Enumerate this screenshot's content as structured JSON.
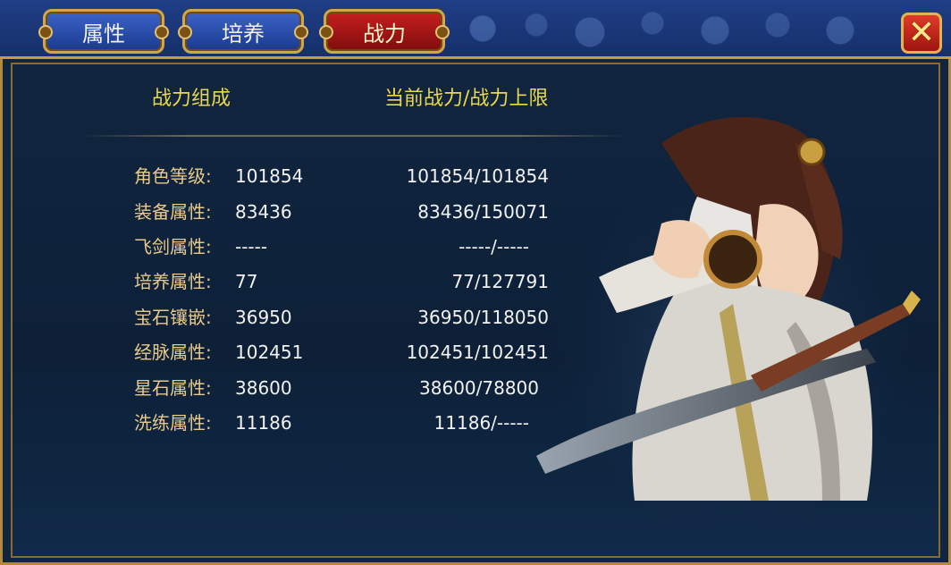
{
  "tabs": [
    {
      "label": "属性"
    },
    {
      "label": "培养"
    },
    {
      "label": "战力",
      "active": true
    }
  ],
  "close_icon": "close-x-icon",
  "headers": {
    "composition": "战力组成",
    "current_max": "当前战力/战力上限"
  },
  "rows": [
    {
      "label": "角色等级:",
      "value": "101854",
      "ratio": "101854/101854"
    },
    {
      "label": "装备属性:",
      "value": "83436",
      "ratio": "83436/150071"
    },
    {
      "label": "飞剑属性:",
      "value": "-----",
      "ratio": "-----/-----"
    },
    {
      "label": "培养属性:",
      "value": "77",
      "ratio": "77/127791"
    },
    {
      "label": "宝石镶嵌:",
      "value": "36950",
      "ratio": "36950/118050"
    },
    {
      "label": "经脉属性:",
      "value": "102451",
      "ratio": "102451/102451"
    },
    {
      "label": "星石属性:",
      "value": "38600",
      "ratio": "38600/78800"
    },
    {
      "label": "洗练属性:",
      "value": "11186",
      "ratio": "11186/-----"
    }
  ],
  "colors": {
    "header": "#e9d84a",
    "label": "#e8c98a",
    "value": "#f2f2f2",
    "tab_active": "#c81f1f",
    "tab_inactive": "#2a4fb0"
  }
}
